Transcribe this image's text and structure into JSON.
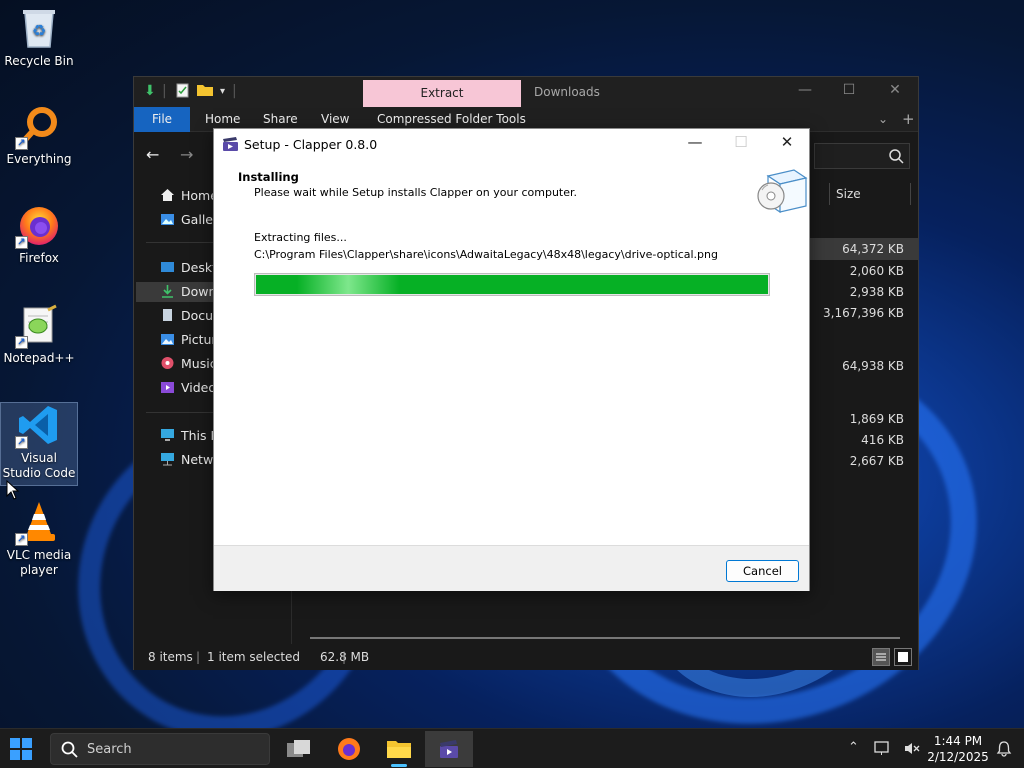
{
  "desktop": {
    "icons": [
      {
        "label": "Recycle Bin"
      },
      {
        "label": "Everything"
      },
      {
        "label": "Firefox"
      },
      {
        "label": "Notepad++"
      },
      {
        "label": "Visual Studio Code"
      },
      {
        "label": "VLC media player"
      }
    ]
  },
  "explorer": {
    "title": "Downloads",
    "extract_tab": "Extract",
    "ribbon": {
      "file": "File",
      "home": "Home",
      "share": "Share",
      "view": "View",
      "compressed": "Compressed Folder Tools"
    },
    "sidebar": {
      "items": [
        {
          "label": "Home"
        },
        {
          "label": "Gallery"
        },
        {
          "label": "Desktop"
        },
        {
          "label": "Downloads"
        },
        {
          "label": "Documents"
        },
        {
          "label": "Pictures"
        },
        {
          "label": "Music"
        },
        {
          "label": "Videos"
        },
        {
          "label": "This PC"
        },
        {
          "label": "Network"
        }
      ]
    },
    "columns": {
      "size": "Size"
    },
    "sizes": [
      "64,372 KB",
      "2,060 KB",
      "2,938 KB",
      "3,167,396 KB",
      "64,938 KB",
      "1,869 KB",
      "416 KB",
      "2,667 KB"
    ],
    "status": {
      "items": "8 items",
      "selected": "1 item selected",
      "size": "62.8 MB"
    }
  },
  "setup": {
    "title": "Setup - Clapper 0.8.0",
    "heading": "Installing",
    "subheading": "Please wait while Setup installs Clapper on your computer.",
    "status": "Extracting files...",
    "file": "C:\\Program Files\\Clapper\\share\\icons\\AdwaitaLegacy\\48x48\\legacy\\drive-optical.png",
    "progress": 1.0,
    "cancel": "Cancel"
  },
  "taskbar": {
    "search": "Search",
    "time": "1:44 PM",
    "date": "2/12/2025"
  },
  "colors": {
    "accent": "#0078d4",
    "progress": "#06b025",
    "extract_tab": "#f7c6d6",
    "file_tab": "#1664c0"
  }
}
